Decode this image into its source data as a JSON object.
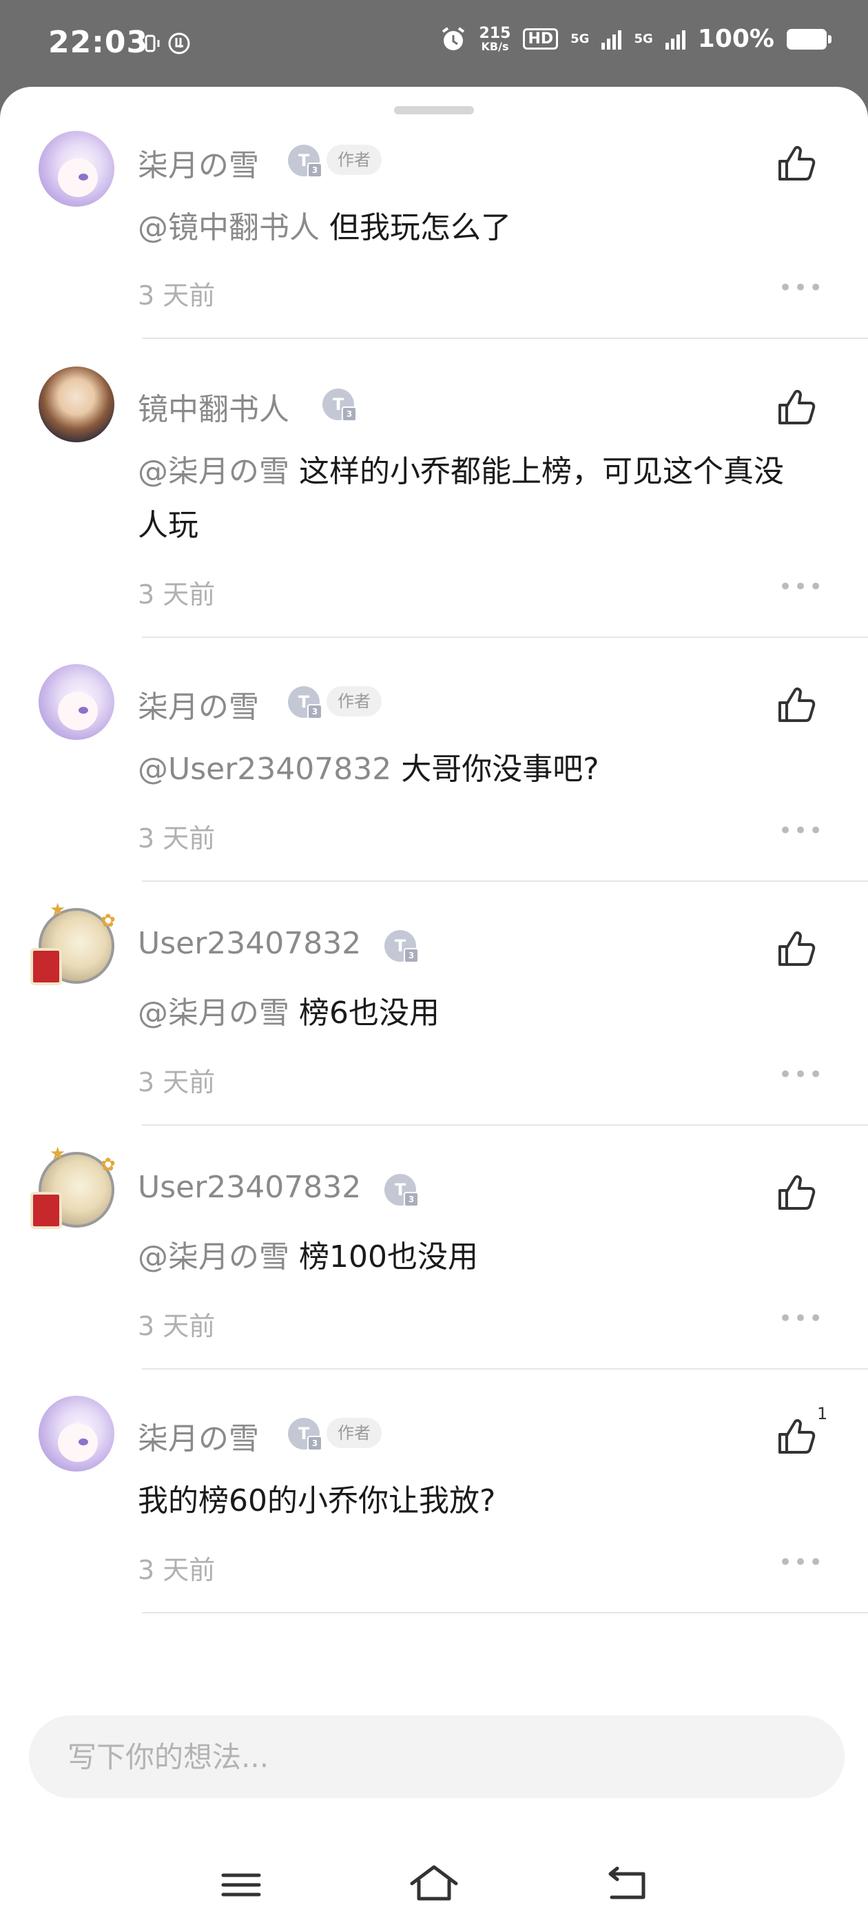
{
  "status_bar": {
    "time": "22:03",
    "speed_value": "215",
    "speed_unit": "KB/s",
    "hd": "HD",
    "net1": "5G",
    "net2": "5G",
    "battery": "100%"
  },
  "comments": [
    {
      "name": "柒月の雪",
      "badge": "T",
      "author_tag": "作者",
      "mention": "@镜中翻书人",
      "text": "但我玩怎么了",
      "time": "3 天前",
      "likes": "",
      "avatar": "purple-hair-girl-avatar"
    },
    {
      "name": "镜中翻书人",
      "badge": "T",
      "author_tag": "",
      "mention": "@柒月の雪",
      "text": "这样的小乔都能上榜，可见这个真没人玩",
      "time": "3 天前",
      "likes": "",
      "avatar": "brown-hair-boy-avatar"
    },
    {
      "name": "柒月の雪",
      "badge": "T",
      "author_tag": "作者",
      "mention": "@User23407832",
      "text": "大哥你没事吧?",
      "time": "3 天前",
      "likes": "",
      "avatar": "purple-hair-girl-avatar"
    },
    {
      "name": "User23407832",
      "badge": "T",
      "author_tag": "",
      "mention": "@柒月の雪",
      "text": "榜6也没用",
      "time": "3 天前",
      "likes": "",
      "avatar": "blonde-framed-avatar"
    },
    {
      "name": "User23407832",
      "badge": "T",
      "author_tag": "",
      "mention": "@柒月の雪",
      "text": "榜100也没用",
      "time": "3 天前",
      "likes": "",
      "avatar": "blonde-framed-avatar"
    },
    {
      "name": "柒月の雪",
      "badge": "T",
      "author_tag": "作者",
      "mention": "",
      "text": "我的榜60的小乔你让我放?",
      "time": "3 天前",
      "likes": "1",
      "avatar": "purple-hair-girl-avatar"
    }
  ],
  "more_glyph": "•••",
  "input": {
    "placeholder": "写下你的想法..."
  },
  "colors": {
    "accent_gray": "#8a8a8a",
    "text_dark": "#1a1a1a",
    "divider": "#e6e6e6"
  }
}
